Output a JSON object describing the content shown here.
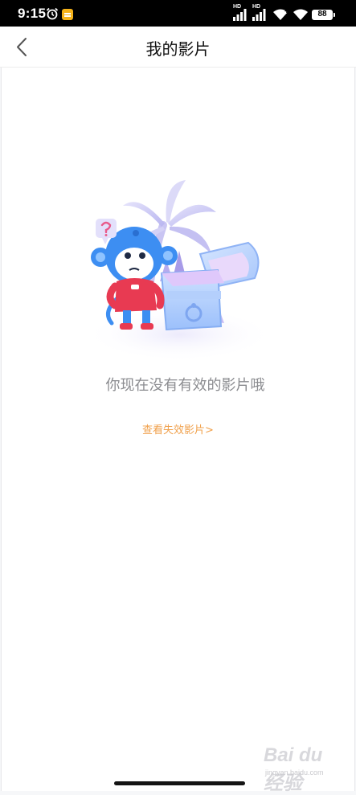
{
  "status_bar": {
    "time": "9:15",
    "hd_1": "HD",
    "hd_2": "HD",
    "battery": "88",
    "icons": [
      "alarm-icon",
      "note-app-icon",
      "signal-icon",
      "signal-icon",
      "wifi-plus-icon",
      "wifi-icon",
      "battery-icon"
    ]
  },
  "nav": {
    "title": "我的影片",
    "back_icon": "chevron-left-icon"
  },
  "empty_state": {
    "message": " 你现在没有有效的影片哦",
    "link": "查看失效影片>",
    "illustration": "monkey-treasure-chest-illustration"
  },
  "watermark": {
    "main": "Bai du 经验",
    "sub": "jingyan.baidu.com"
  },
  "colors": {
    "link": "#f0a04b",
    "message": "#8b8c90",
    "title": "#111111"
  }
}
